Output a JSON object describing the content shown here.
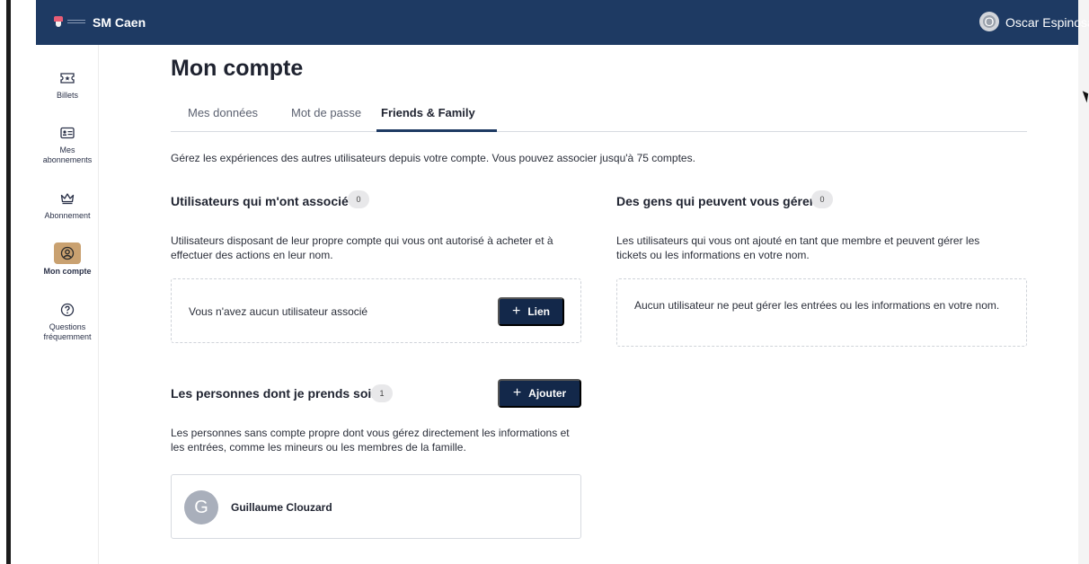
{
  "header": {
    "brand_name": "SM Caen",
    "user_initial": "O",
    "user_name": "Oscar Espinosa"
  },
  "sidebar": {
    "items": [
      {
        "label": "Billets",
        "icon": "ticket-icon",
        "active": false
      },
      {
        "label": "Mes abonnements",
        "icon": "id-card-icon",
        "active": false
      },
      {
        "label": "Abonnement",
        "icon": "crown-icon",
        "active": false
      },
      {
        "label": "Mon compte",
        "icon": "user-circle-icon",
        "active": true
      },
      {
        "label": "Questions fréquemment",
        "icon": "question-circle-icon",
        "active": false
      }
    ]
  },
  "page": {
    "title": "Mon compte",
    "tabs": [
      {
        "label": "Mes données"
      },
      {
        "label": "Mot de passe"
      },
      {
        "label": "Friends & Family"
      }
    ],
    "active_tab": "Friends & Family",
    "intro": "Gérez les expériences des autres utilisateurs depuis votre compte. Vous pouvez associer jusqu'à 75 comptes."
  },
  "associated_users": {
    "title": "Utilisateurs qui m'ont associé",
    "count": "0",
    "description": "Utilisateurs disposant de leur propre compte qui vous ont autorisé à acheter et à effectuer des actions en leur nom.",
    "empty_text": "Vous n'avez aucun utilisateur associé",
    "button_label": "Lien"
  },
  "managers": {
    "title": "Des gens qui peuvent vous gérer",
    "count": "0",
    "description": "Les utilisateurs qui vous ont ajouté en tant que membre et peuvent gérer les tickets ou les informations en votre nom.",
    "empty_text": "Aucun utilisateur ne peut gérer les entrées ou les informations en votre nom."
  },
  "care": {
    "title": "Les personnes dont je prends soin",
    "count": "1",
    "button_label": "Ajouter",
    "description": "Les personnes sans compte propre dont vous gérez directement les informations et les entrées, comme les mineurs ou les membres de la famille.",
    "people": [
      {
        "initial": "G",
        "name": "Guillaume Clouzard"
      }
    ]
  },
  "colors": {
    "topbar": "#1e3a63",
    "primary_button": "#13284a",
    "active_nav": "#c9a170"
  }
}
